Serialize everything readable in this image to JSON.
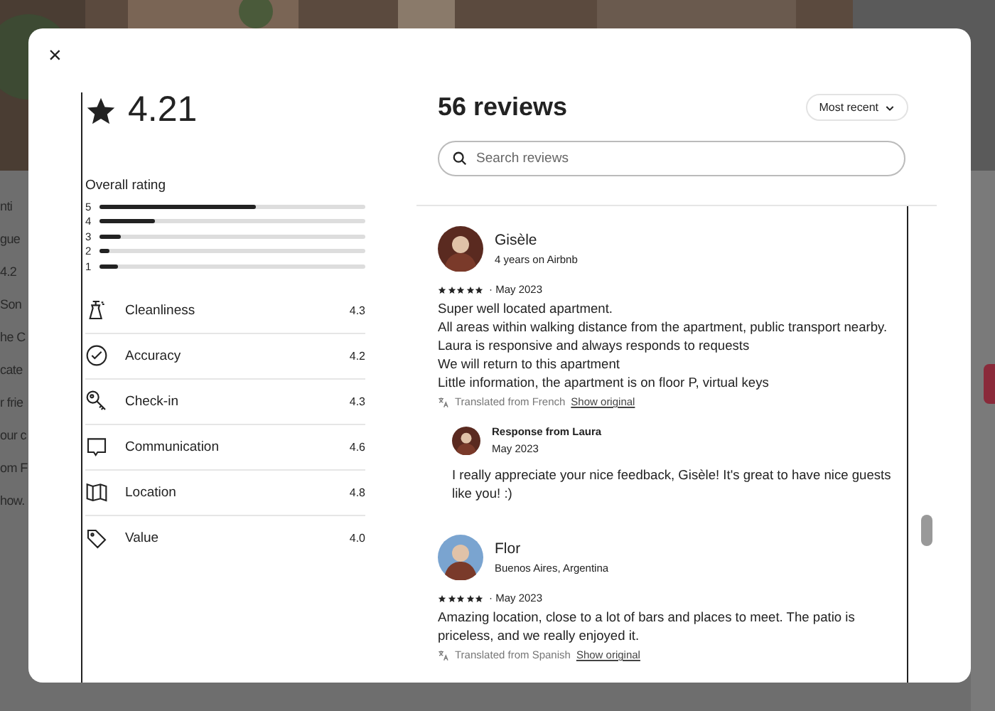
{
  "background_page": {
    "fragments": [
      "nti",
      "gue",
      "4.2",
      "Son",
      "he C",
      "cate",
      "r frie",
      "our c",
      "om F",
      "how."
    ]
  },
  "modal": {
    "close": "×",
    "rating": "4.21",
    "overall": {
      "title": "Overall rating",
      "bars": [
        {
          "label": "5",
          "level": 0.59
        },
        {
          "label": "4",
          "level": 0.21
        },
        {
          "label": "3",
          "level": 0.08
        },
        {
          "label": "2",
          "level": 0.04
        },
        {
          "label": "1",
          "level": 0.07
        }
      ]
    },
    "categories": [
      {
        "kind": "cleanliness",
        "label": "Cleanliness",
        "score": "4.3"
      },
      {
        "kind": "accuracy",
        "label": "Accuracy",
        "score": "4.2"
      },
      {
        "kind": "checkin",
        "label": "Check-in",
        "score": "4.3"
      },
      {
        "kind": "communication",
        "label": "Communication",
        "score": "4.6"
      },
      {
        "kind": "location",
        "label": "Location",
        "score": "4.8"
      },
      {
        "kind": "value",
        "label": "Value",
        "score": "4.0"
      }
    ],
    "reviews_panel": {
      "title": "56 reviews",
      "sort": "Most recent",
      "search": {
        "placeholder": "Search reviews"
      },
      "reviews": [
        {
          "name": "Gisèle",
          "subtitle": "4 years on Airbnb",
          "stars": 5,
          "date": "· May 2023",
          "lines": [
            "Super well located apartment.",
            "All areas within walking distance from the apartment, public transport nearby.",
            "Laura is responsive and always responds to requests",
            "We will return to this apartment",
            "Little information, the apartment is on floor P, virtual keys"
          ],
          "translation": "Translated from French",
          "show_original": "Show original",
          "response": {
            "title": "Response from Laura",
            "date": "May 2023",
            "text": "I really appreciate your nice feedback, Gisèle! It's great to have nice guests like you! :)"
          }
        },
        {
          "name": "Flor",
          "subtitle": "Buenos Aires, Argentina",
          "stars": 5,
          "date": "· May 2023",
          "lines": [
            "Amazing location, close to a lot of bars and places to meet. The patio is priceless, and we really enjoyed it."
          ],
          "translation": "Translated from Spanish",
          "show_original": "Show original"
        }
      ]
    }
  }
}
